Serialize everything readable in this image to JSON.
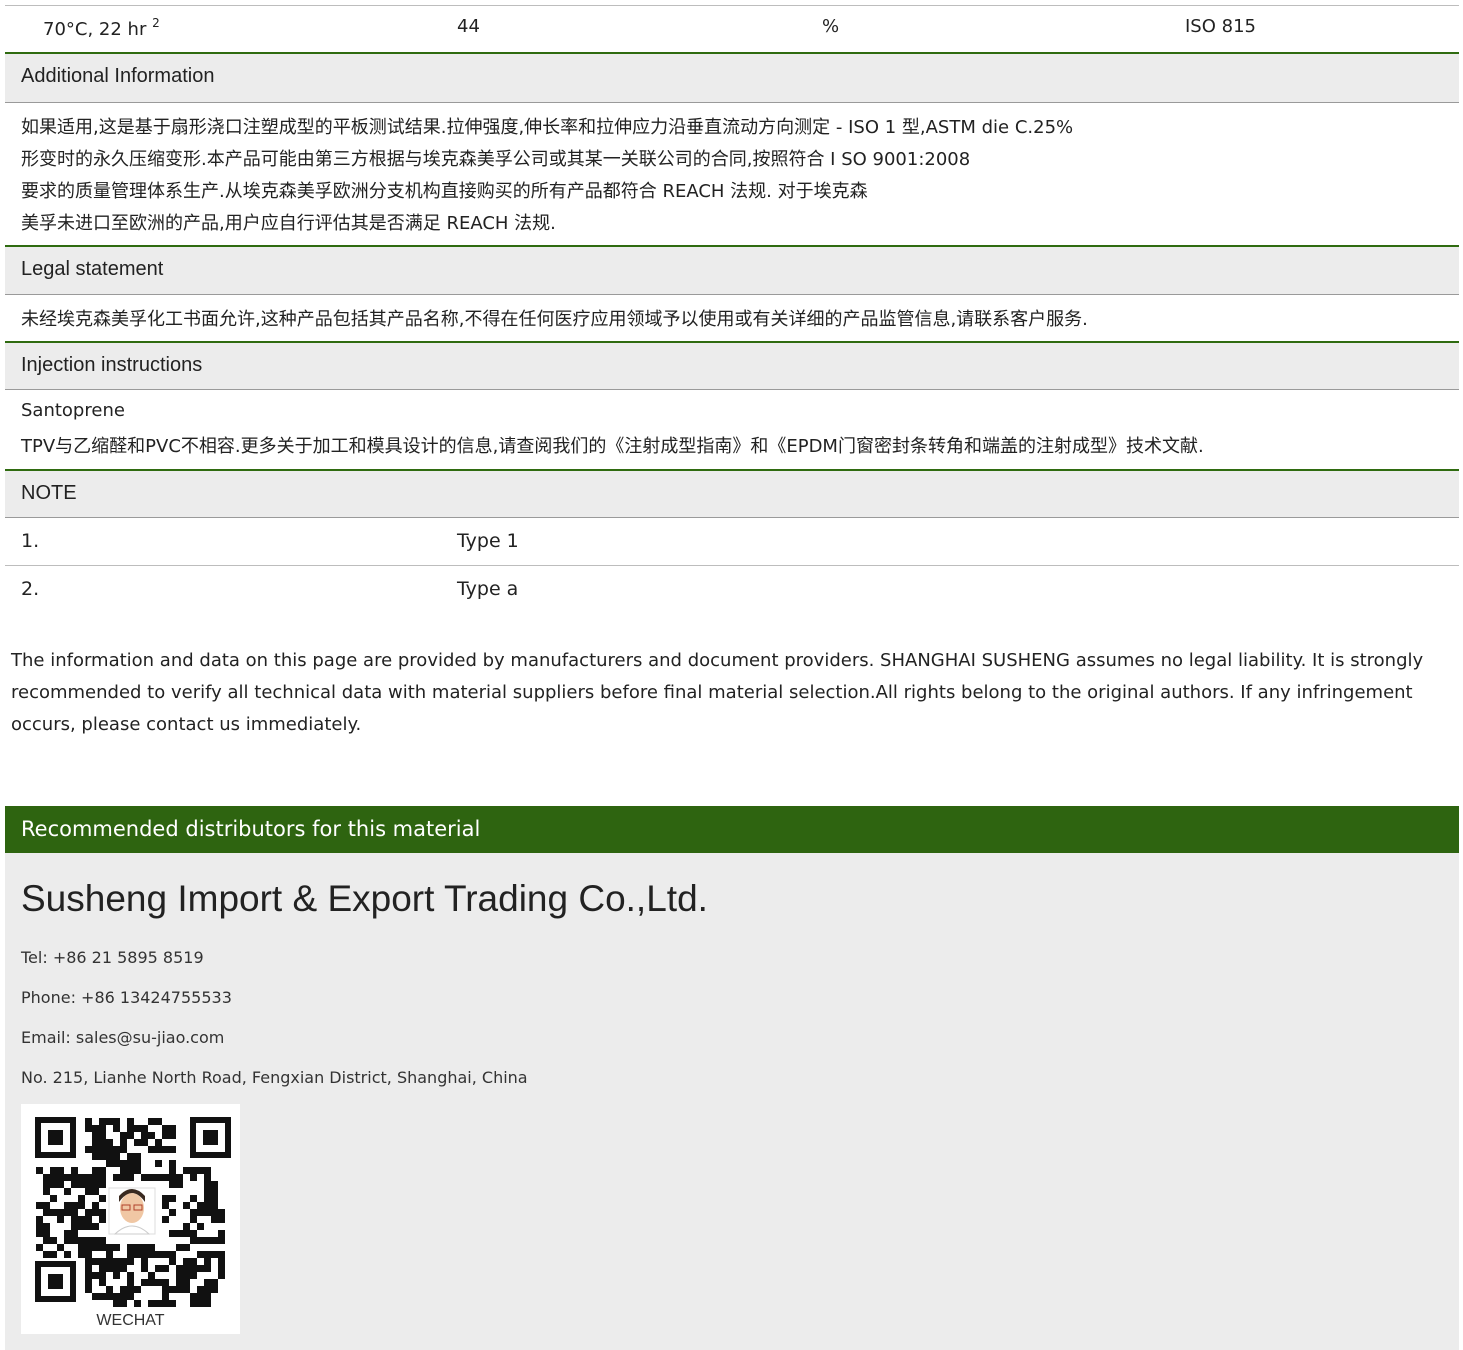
{
  "top_row": {
    "condition": "70°C, 22 hr",
    "note_ref": "2",
    "value": "44",
    "unit": "%",
    "standard": "ISO 815"
  },
  "sections": {
    "additional_info": {
      "title": "Additional Information",
      "lines": [
        "如果适用,这是基于扇形浇口注塑成型的平板测试结果.拉伸强度,伸长率和拉伸应力沿垂直流动方向测定 - ISO 1 型,ASTM die C.25%",
        "形变时的永久压缩变形.本产品可能由第三方根据与埃克森美孚公司或其某一关联公司的合同,按照符合 I SO 9001:2008",
        "要求的质量管理体系生产.从埃克森美孚欧洲分支机构直接购买的所有产品都符合 REACH 法规. 对于埃克森",
        "美孚未进口至欧洲的产品,用户应自行评估其是否满足 REACH 法规."
      ]
    },
    "legal": {
      "title": "Legal statement",
      "lines": [
        "未经埃克森美孚化工书面允许,这种产品包括其产品名称,不得在任何医疗应用领域予以使用或有关详细的产品监管信息,请联系客户服务."
      ]
    },
    "injection": {
      "title": "Injection instructions",
      "lines": [
        "Santoprene",
        "TPV与乙缩醛和PVC不相容.更多关于加工和模具设计的信息,请查阅我们的《注射成型指南》和《EPDM门窗密封条转角和端盖的注射成型》技术文献."
      ]
    },
    "note": {
      "title": "NOTE",
      "rows": [
        {
          "num": "1.",
          "text": "Type 1"
        },
        {
          "num": "2.",
          "text": "Type a"
        }
      ]
    }
  },
  "disclaimer": "The information and data on this page are provided by manufacturers and document providers.  SHANGHAI SUSHENG  assumes no legal liability. It is strongly recommended to verify all technical data with material suppliers before final material selection.All rights belong to the original authors. If any infringement occurs, please contact us immediately.",
  "distributors": {
    "heading": "Recommended distributors for this material",
    "company": "Susheng Import & Export Trading Co.,Ltd.",
    "tel": "Tel: +86 21 5895 8519",
    "phone": "Phone: +86 13424755533",
    "email": "Email: sales@su-jiao.com",
    "address": "No. 215, Lianhe North Road, Fengxian District, Shanghai, China",
    "qr_caption": "WECHAT"
  },
  "colors": {
    "accent_green": "#2e6410",
    "header_gray": "#ececec"
  },
  "icons": {
    "qr": "wechat-qr-code-icon",
    "avatar": "profile-photo"
  }
}
